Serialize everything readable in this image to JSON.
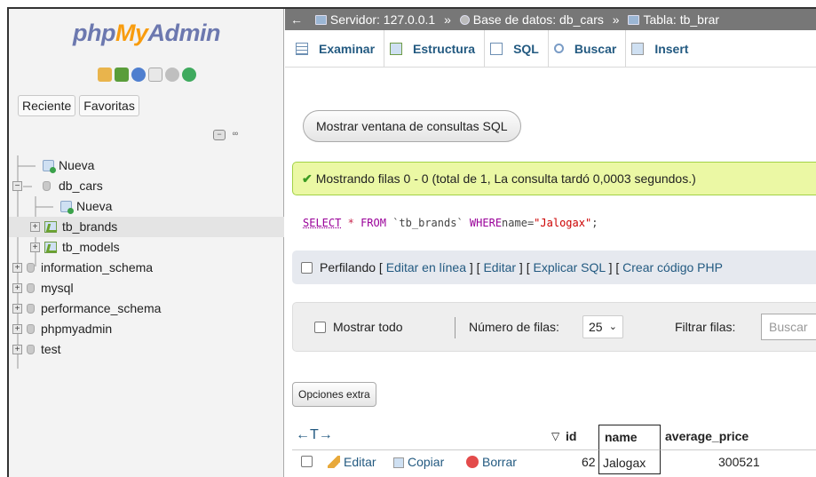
{
  "sidebar": {
    "logo": {
      "php": "php",
      "my": "My",
      "admin": "Admin"
    },
    "tabs": [
      "Reciente",
      "Favoritas"
    ],
    "tree": [
      {
        "label": "Nueva",
        "type": "new",
        "level": 0
      },
      {
        "label": "db_cars",
        "type": "db",
        "level": 0,
        "expanded": true
      },
      {
        "label": "Nueva",
        "type": "new",
        "level": 1
      },
      {
        "label": "tb_brands",
        "type": "table",
        "level": 1,
        "highlighted": true
      },
      {
        "label": "tb_models",
        "type": "table",
        "level": 1
      },
      {
        "label": "information_schema",
        "type": "db",
        "level": 0
      },
      {
        "label": "mysql",
        "type": "db",
        "level": 0
      },
      {
        "label": "performance_schema",
        "type": "db",
        "level": 0
      },
      {
        "label": "phpmyadmin",
        "type": "db",
        "level": 0
      },
      {
        "label": "test",
        "type": "db",
        "level": 0
      }
    ]
  },
  "breadcrumb": {
    "back": "←",
    "server": "Servidor: 127.0.0.1",
    "sep": "»",
    "database": "Base de datos: db_cars",
    "table": "Tabla: tb_brar"
  },
  "menu": [
    {
      "label": "Examinar",
      "icon": "browse-icon"
    },
    {
      "label": "Estructura",
      "icon": "structure-icon"
    },
    {
      "label": "SQL",
      "icon": "sql-icon"
    },
    {
      "label": "Buscar",
      "icon": "search-icon"
    },
    {
      "label": "Insert",
      "icon": "insert-icon"
    }
  ],
  "main": {
    "show_sql_button": "Mostrar ventana de consultas SQL",
    "success_message": "Mostrando filas 0 - 0 (total de 1, La consulta tardó 0,0003 segundos.)",
    "sql": {
      "select": "SELECT",
      "star": "*",
      "from": "FROM",
      "table": "`tb_brands`",
      "where": "WHERE",
      "field": "name=",
      "value": "\"Jalogax\"",
      "end": ";"
    },
    "profiling": {
      "label": "Perfilando",
      "links": [
        "Editar en línea",
        "Editar",
        "Explicar SQL",
        "Crear código PHP"
      ]
    },
    "nav": {
      "show_all": "Mostrar todo",
      "rows_label": "Número de filas:",
      "rows_value": "25",
      "filter_label": "Filtrar filas:",
      "filter_placeholder": "Buscar"
    },
    "extra_options": "Opciones extra",
    "table": {
      "arrows": "←T→",
      "sort_glyph": "▽",
      "columns": [
        "id",
        "name",
        "average_price"
      ],
      "rows": [
        {
          "actions": [
            "Editar",
            "Copiar",
            "Borrar"
          ],
          "id": "62",
          "name": "Jalogax",
          "average_price": "300521"
        }
      ]
    }
  },
  "colors": {
    "link": "#235a81",
    "success_bg": "#ebf8a4",
    "breadcrumb_bg": "#777777"
  }
}
